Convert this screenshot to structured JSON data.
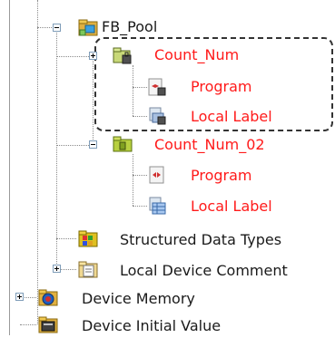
{
  "tree": {
    "fb_pool": "FB_Pool",
    "count_num": "Count_Num",
    "count_num_program": "Program",
    "count_num_local_label": "Local Label",
    "count_num_02": "Count_Num_02",
    "count_num_02_program": "Program",
    "count_num_02_local_label": "Local Label",
    "structured_data_types": "Structured Data Types",
    "local_device_comment": "Local Device Comment",
    "device_memory": "Device Memory",
    "device_initial_value": "Device Initial Value"
  },
  "colors": {
    "highlight_text": "#ff1a1a",
    "normal_text": "#1a1a1a"
  },
  "icons": [
    "folder-icon",
    "function-block-icon",
    "program-icon",
    "local-label-icon",
    "structured-data-icon",
    "device-comment-icon",
    "device-memory-icon",
    "device-initial-value-icon"
  ]
}
